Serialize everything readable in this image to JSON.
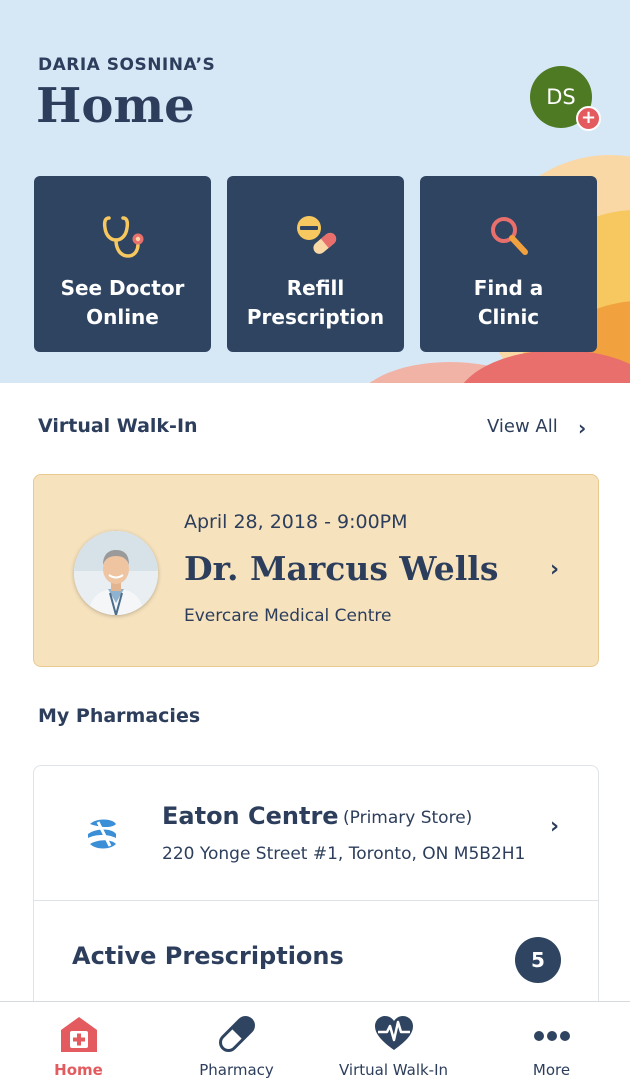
{
  "header": {
    "owner_label": "DARIA SOSNINA’S",
    "title": "Home",
    "avatar_initials": "DS",
    "avatar_badge": "+",
    "actions": [
      {
        "line1": "See Doctor",
        "line2": "Online",
        "icon": "stethoscope-icon"
      },
      {
        "line1": "Refill",
        "line2": "Prescription",
        "icon": "pills-icon"
      },
      {
        "line1": "Find a",
        "line2": "Clinic",
        "icon": "search-icon"
      }
    ]
  },
  "virtual_walkin": {
    "section_title": "Virtual Walk-In",
    "view_all": "View All",
    "appointment": {
      "datetime": "April 28, 2018 - 9:00PM",
      "doctor": "Dr. Marcus Wells",
      "clinic": "Evercare Medical Centre"
    }
  },
  "pharmacies": {
    "section_title": "My Pharmacies",
    "store_name": "Eaton Centre",
    "store_tag": "(Primary Store)",
    "address": "220 Yonge Street #1, Toronto, ON M5B2H1",
    "active_rx_label": "Active Prescriptions",
    "active_rx_count": "5"
  },
  "tabbar": {
    "tabs": [
      {
        "label": "Home",
        "icon": "home-icon",
        "active": true
      },
      {
        "label": "Pharmacy",
        "icon": "pill-icon",
        "active": false
      },
      {
        "label": "Virtual Walk-In",
        "icon": "heart-pulse-icon",
        "active": false
      },
      {
        "label": "More",
        "icon": "more-icon",
        "active": false
      }
    ]
  },
  "colors": {
    "header_bg": "#d6e7f6",
    "navy": "#2f4461",
    "accent_red": "#e35b5e",
    "appointment_bg": "#f6e2bd",
    "avatar_green": "#4d7a22"
  }
}
